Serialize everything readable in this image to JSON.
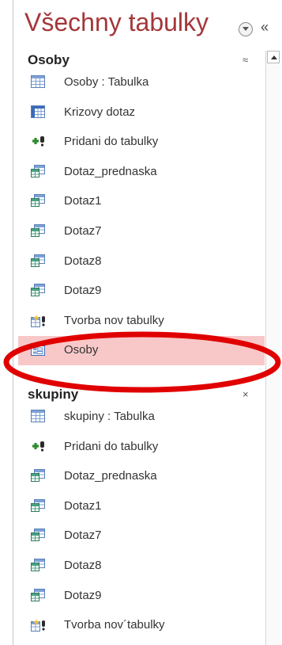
{
  "navigation_pane": {
    "title": "Všechny tabulky",
    "menu_icon": "dropdown-circle-icon",
    "collapse_icon": "double-chevron-left-icon",
    "collapse_glyph": "«",
    "groups": [
      {
        "label": "Osoby",
        "toggle_glyph": "≈",
        "items": [
          {
            "label": "Osoby : Tabulka",
            "icon": "table-icon"
          },
          {
            "label": "Krizovy dotaz",
            "icon": "crosstab-query-icon"
          },
          {
            "label": "Pridani do tabulky",
            "icon": "append-query-icon"
          },
          {
            "label": "Dotaz_prednaska",
            "icon": "select-query-icon"
          },
          {
            "label": "Dotaz1",
            "icon": "select-query-icon"
          },
          {
            "label": "Dotaz7",
            "icon": "select-query-icon"
          },
          {
            "label": "Dotaz8",
            "icon": "select-query-icon"
          },
          {
            "label": "Dotaz9",
            "icon": "select-query-icon"
          },
          {
            "label": "Tvorba nov tabulky",
            "icon": "make-table-query-icon"
          },
          {
            "label": "Osoby",
            "icon": "form-icon",
            "selected": true
          }
        ]
      },
      {
        "label": "skupiny",
        "toggle_glyph": "×",
        "items": [
          {
            "label": "skupiny : Tabulka",
            "icon": "table-icon"
          },
          {
            "label": "Pridani do tabulky",
            "icon": "append-query-icon"
          },
          {
            "label": "Dotaz_prednaska",
            "icon": "select-query-icon"
          },
          {
            "label": "Dotaz1",
            "icon": "select-query-icon"
          },
          {
            "label": "Dotaz7",
            "icon": "select-query-icon"
          },
          {
            "label": "Dotaz8",
            "icon": "select-query-icon"
          },
          {
            "label": "Dotaz9",
            "icon": "select-query-icon"
          },
          {
            "label": "Tvorba nov´tabulky",
            "icon": "make-table-query-icon"
          }
        ]
      }
    ]
  },
  "colors": {
    "title": "#a4373a",
    "selected_row": "#f8c8c9",
    "annotation": "#e00000"
  }
}
